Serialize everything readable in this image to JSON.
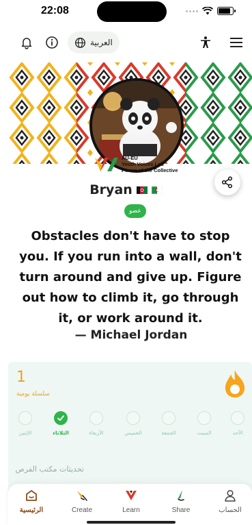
{
  "status_bar": {
    "time": "22:08"
  },
  "header": {
    "language_label": "العربية",
    "icons": [
      "bell-icon",
      "info-icon",
      "globe-icon",
      "accessibility-icon",
      "menu-icon"
    ]
  },
  "banner": {
    "logo_line1": "AU-EU",
    "logo_line2": "Youth Voices Lab",
    "logo_line3": "Power of the Collective"
  },
  "profile": {
    "name": "Bryan",
    "role_badge": "عضو"
  },
  "quote": {
    "text": "Obstacles don't have to stop you. If you run into a wall, don't turn around and give up. Figure out how to climb it, go through it, or work around it.",
    "author": "— Michael Jordan"
  },
  "streak": {
    "count": "1",
    "label": "سلسلة يومية",
    "days": [
      {
        "label": "الأحد",
        "done": false
      },
      {
        "label": "السبت",
        "done": false
      },
      {
        "label": "الجمعة",
        "done": false
      },
      {
        "label": "الخميس",
        "done": false
      },
      {
        "label": "الأربعاء",
        "done": false
      },
      {
        "label": "الثلاثاء",
        "done": true
      },
      {
        "label": "الإثنين",
        "done": false
      }
    ]
  },
  "challenges": {
    "title": "تحديثات مكتب الفرص"
  },
  "nav": {
    "items": [
      {
        "label": "الرئيسية",
        "icon": "home-icon",
        "active": true
      },
      {
        "label": "Create",
        "icon": "create-icon",
        "active": false
      },
      {
        "label": "Learn",
        "icon": "learn-icon",
        "active": false
      },
      {
        "label": "Share",
        "icon": "share-nav-icon",
        "active": false
      },
      {
        "label": "الحساب",
        "icon": "account-icon",
        "active": false
      }
    ]
  },
  "colors": {
    "accent_green": "#2fb34a",
    "streak_orange": "#f0a020",
    "nav_active": "#8a4b1a",
    "card_bg": "#eef7f3"
  }
}
